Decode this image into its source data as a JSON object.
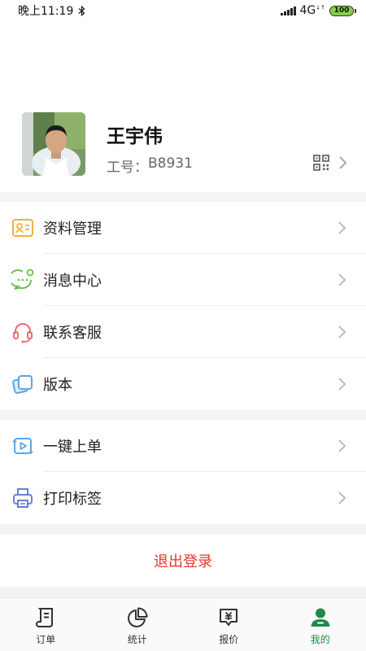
{
  "status_bar": {
    "time": "晚上11:19",
    "network": "4G",
    "battery": "100"
  },
  "profile": {
    "name": "王宇伟",
    "id_label": "工号：",
    "id_value": "B8931"
  },
  "menu_group_1": [
    {
      "label": "资料管理",
      "icon": "profile-card-icon"
    },
    {
      "label": "消息中心",
      "icon": "message-bubble-icon"
    },
    {
      "label": "联系客服",
      "icon": "headset-icon"
    },
    {
      "label": "版本",
      "icon": "version-cards-icon"
    }
  ],
  "menu_group_2": [
    {
      "label": "一键上单",
      "icon": "one-click-order-icon"
    },
    {
      "label": "打印标签",
      "icon": "printer-icon"
    }
  ],
  "logout_label": "退出登录",
  "tabs": [
    {
      "label": "订单",
      "icon": "order-scroll-icon",
      "active": false
    },
    {
      "label": "统计",
      "icon": "pie-chart-icon",
      "active": false
    },
    {
      "label": "报价",
      "icon": "price-tag-icon",
      "active": false
    },
    {
      "label": "我的",
      "icon": "user-icon",
      "active": true
    }
  ],
  "colors": {
    "accent_green": "#1f8a4c",
    "logout_red": "#e5362b",
    "background_gray": "#f3f3f3"
  }
}
